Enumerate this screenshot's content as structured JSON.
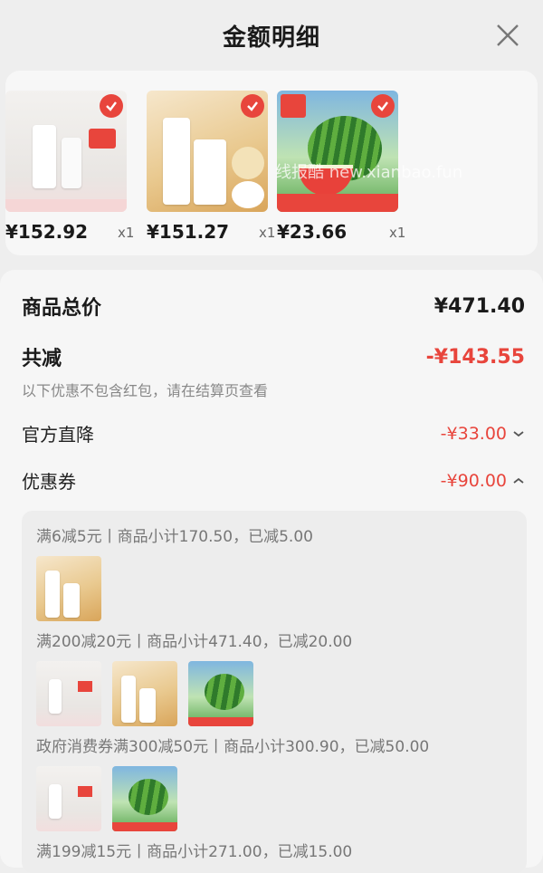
{
  "header": {
    "title": "金额明细"
  },
  "products": [
    {
      "price": "¥152.92",
      "qty": "x1",
      "art": "skincare"
    },
    {
      "price": "¥151.27",
      "qty": "x1",
      "art": "perfume-lotion"
    },
    {
      "price": "¥23.66",
      "qty": "x1",
      "art": "watermelon"
    }
  ],
  "watermark": "线报酷 new.xianbao.fun",
  "summary": {
    "total_label": "商品总价",
    "total_value": "¥471.40",
    "reduce_label": "共减",
    "reduce_value": "-¥143.55",
    "note": "以下优惠不包含红包，请在结算页查看",
    "direct_label": "官方直降",
    "direct_value": "-¥33.00",
    "coupon_label": "优惠券",
    "coupon_value": "-¥90.00"
  },
  "coupons": [
    {
      "text": "满6减5元丨商品小计170.50，已减5.00"
    },
    {
      "text": "满200减20元丨商品小计471.40，已减20.00"
    },
    {
      "text": "政府消费券满300减50元丨商品小计300.90，已减50.00"
    },
    {
      "text": "满199减15元丨商品小计271.00，已减15.00"
    }
  ],
  "colors": {
    "accent_red": "#e8453c",
    "background": "#eeeeee",
    "card": "#f7f7f7"
  }
}
